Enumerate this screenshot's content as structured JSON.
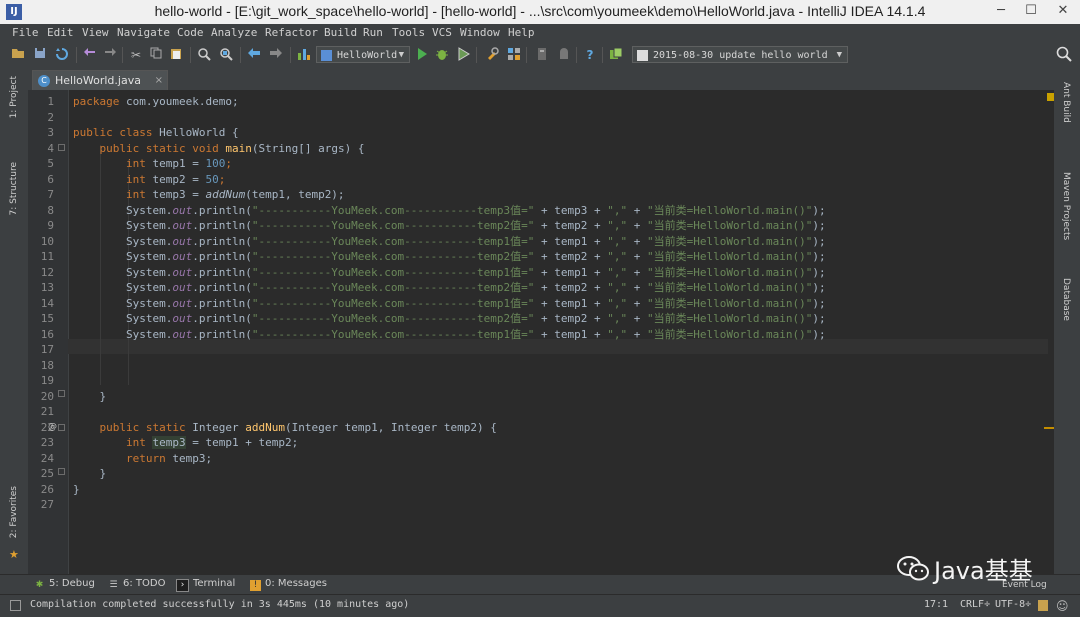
{
  "window": {
    "title": "hello-world - [E:\\git_work_space\\hello-world] - [hello-world] - ...\\src\\com\\youmeek\\demo\\HelloWorld.java - IntelliJ IDEA 14.1.4",
    "logo": "IJ",
    "minimize": "─",
    "maximize": "☐",
    "close": "✕"
  },
  "menu": [
    "File",
    "Edit",
    "View",
    "Navigate",
    "Code",
    "Analyze",
    "Refactor",
    "Build",
    "Run",
    "Tools",
    "VCS",
    "Window",
    "Help"
  ],
  "toolbar": {
    "run_config": "HelloWorld",
    "vcs_commit": "2015-08-30 update hello world",
    "icons": [
      "open-icon",
      "save-icon",
      "sync-icon",
      "undo-icon",
      "redo-icon",
      "cut-icon",
      "copy-icon",
      "paste-icon",
      "find-icon",
      "replace-icon",
      "back-icon",
      "forward-icon",
      "make-icon",
      "run-icon",
      "debug-icon",
      "coverage-icon",
      "settings-icon",
      "project-structure-icon",
      "sdk-icon",
      "android-icon",
      "help-icon",
      "vcs-icon",
      "search-icon"
    ]
  },
  "tab": {
    "label": "HelloWorld.java",
    "close": "×"
  },
  "left_panels": {
    "project": "1: Project",
    "structure": "7: Structure",
    "favorites": "2: Favorites"
  },
  "right_panels": {
    "ant": "Ant Build",
    "maven": "Maven Projects",
    "database": "Database"
  },
  "editor": {
    "line_numbers": [
      "1",
      "2",
      "3",
      "4",
      "5",
      "6",
      "7",
      "8",
      "9",
      "10",
      "11",
      "12",
      "13",
      "14",
      "15",
      "16",
      "17",
      "18",
      "19",
      "20",
      "21",
      "22",
      "23",
      "24",
      "25",
      "26",
      "27"
    ],
    "override_marker": "@",
    "s": {
      "package": "package",
      "pkgname": " com.youmeek.demo;",
      "public": "public",
      "class": "class",
      "static": "static",
      "void": "void",
      "int": "int",
      "return": "return",
      "classname": " HelloWorld {",
      "main": "main",
      "mainargs": "(String[] args) {",
      "temp1": "temp1 = ",
      "v100": "100",
      "temp2": "temp2 = ",
      "v50": "50",
      "semi": ";",
      "temp3": "temp3 = ",
      "addNum": "addNum",
      "call": "(temp1, temp2);",
      "sys": "System.",
      "out": "out",
      "println": ".println(",
      "dash": "\"-----------YouMeek.com-----------",
      "lbl3": "temp3值=\"",
      "lbl2": "temp2值=\"",
      "lbl1": "temp1值=\"",
      "plus3": " + temp3 + ",
      "plus2": " + temp2 + ",
      "plus1": " + temp1 + ",
      "comma": "\",\"",
      "plus": " + ",
      "where": "\"当前类=HelloWorld.main()\"",
      "end": ");",
      "rbrace": "}",
      "integer": " Integer ",
      "addsig": "(Integer temp1, Integer temp2) {",
      "tempvar": "temp3",
      "sum": " = temp1 + temp2;",
      "ret": " temp3;"
    }
  },
  "tool_windows": [
    "5: Debug",
    "6: TODO",
    "Terminal",
    "0: Messages"
  ],
  "event_log": "Event Log",
  "status": {
    "message": "Compilation completed successfully in 3s 445ms (10 minutes ago)",
    "position": "17:1",
    "line_sep": "CRLF÷",
    "encoding": "UTF-8÷"
  },
  "watermark": "Java基基"
}
